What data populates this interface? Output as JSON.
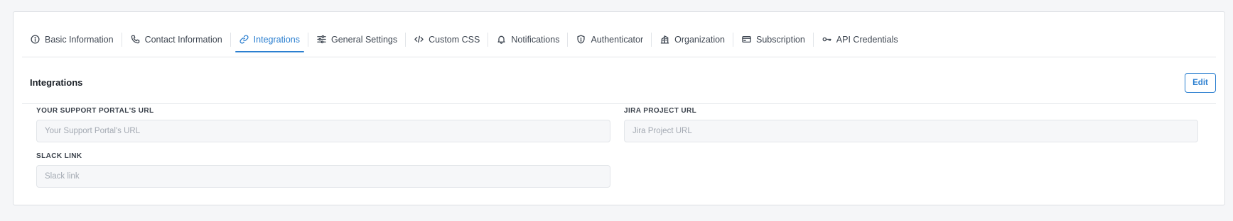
{
  "tabs": [
    {
      "label": "Basic Information",
      "icon": "info-icon"
    },
    {
      "label": "Contact Information",
      "icon": "phone-icon"
    },
    {
      "label": "Integrations",
      "icon": "link-icon",
      "active": true
    },
    {
      "label": "General Settings",
      "icon": "sliders-icon"
    },
    {
      "label": "Custom CSS",
      "icon": "code-icon"
    },
    {
      "label": "Notifications",
      "icon": "bell-icon"
    },
    {
      "label": "Authenticator",
      "icon": "shield-icon"
    },
    {
      "label": "Organization",
      "icon": "building-icon"
    },
    {
      "label": "Subscription",
      "icon": "credit-card-icon"
    },
    {
      "label": "API Credentials",
      "icon": "key-icon"
    }
  ],
  "section": {
    "title": "Integrations",
    "edit_label": "Edit"
  },
  "fields": {
    "support_portal": {
      "label": "YOUR SUPPORT PORTAL'S URL",
      "value": "",
      "placeholder": "Your Support Portal's URL"
    },
    "jira": {
      "label": "JIRA PROJECT URL",
      "value": "",
      "placeholder": "Jira Project URL"
    },
    "slack": {
      "label": "SLACK LINK",
      "value": "",
      "placeholder": "Slack link"
    }
  },
  "colors": {
    "accent": "#2b7fd0",
    "page_bg": "#f5f6f8",
    "input_bg": "#f6f7f9"
  }
}
